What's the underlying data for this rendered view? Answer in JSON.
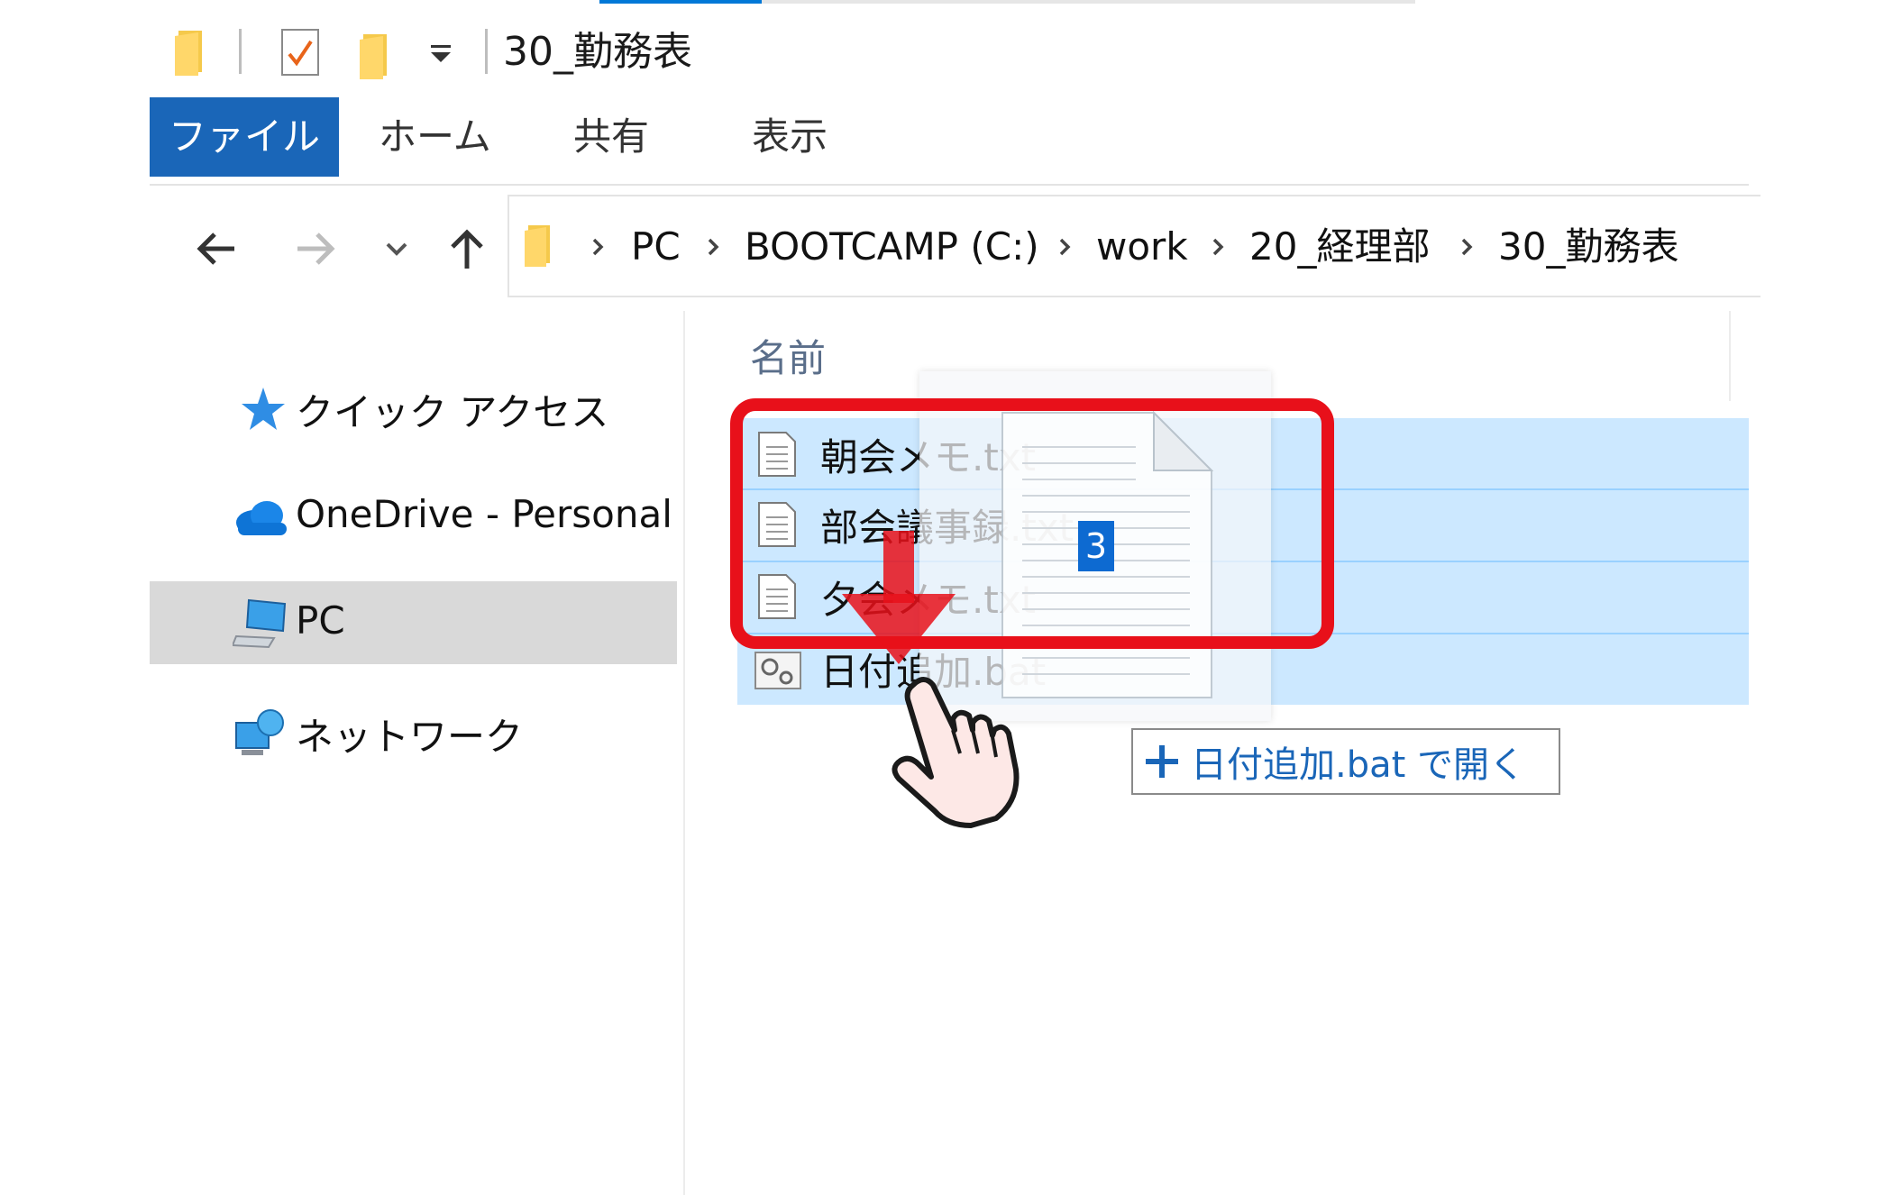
{
  "window": {
    "title": "30_勤務表"
  },
  "ribbon": {
    "tabs": [
      "ファイル",
      "ホーム",
      "共有",
      "表示"
    ]
  },
  "address_bar": {
    "crumbs": [
      "PC",
      "BOOTCAMP (C:)",
      "work",
      "20_経理部",
      "30_勤務表"
    ]
  },
  "sidebar": {
    "items": [
      {
        "label": "クイック アクセス",
        "icon": "star-icon"
      },
      {
        "label": "OneDrive - Personal",
        "icon": "cloud-icon"
      },
      {
        "label": "PC",
        "icon": "computer-icon",
        "selected": true
      },
      {
        "label": "ネットワーク",
        "icon": "network-icon"
      }
    ]
  },
  "file_list": {
    "column_name": "名前",
    "files": [
      {
        "name": "朝会メモ.txt",
        "icon": "text-file-icon",
        "selected": true
      },
      {
        "name": "部会議事録.txt",
        "icon": "text-file-icon",
        "selected": true
      },
      {
        "name": "夕会メモ.txt",
        "icon": "text-file-icon",
        "selected": true
      },
      {
        "name": "日付追加.bat",
        "icon": "batch-file-icon",
        "selected": true
      }
    ]
  },
  "drag": {
    "count": "3",
    "tooltip_text": "日付追加.bat で開く"
  },
  "colors": {
    "accent": "#1a66b8",
    "selection": "#cce8ff",
    "highlight_box": "#e8101a",
    "drag_arrow": "#e8101a"
  }
}
